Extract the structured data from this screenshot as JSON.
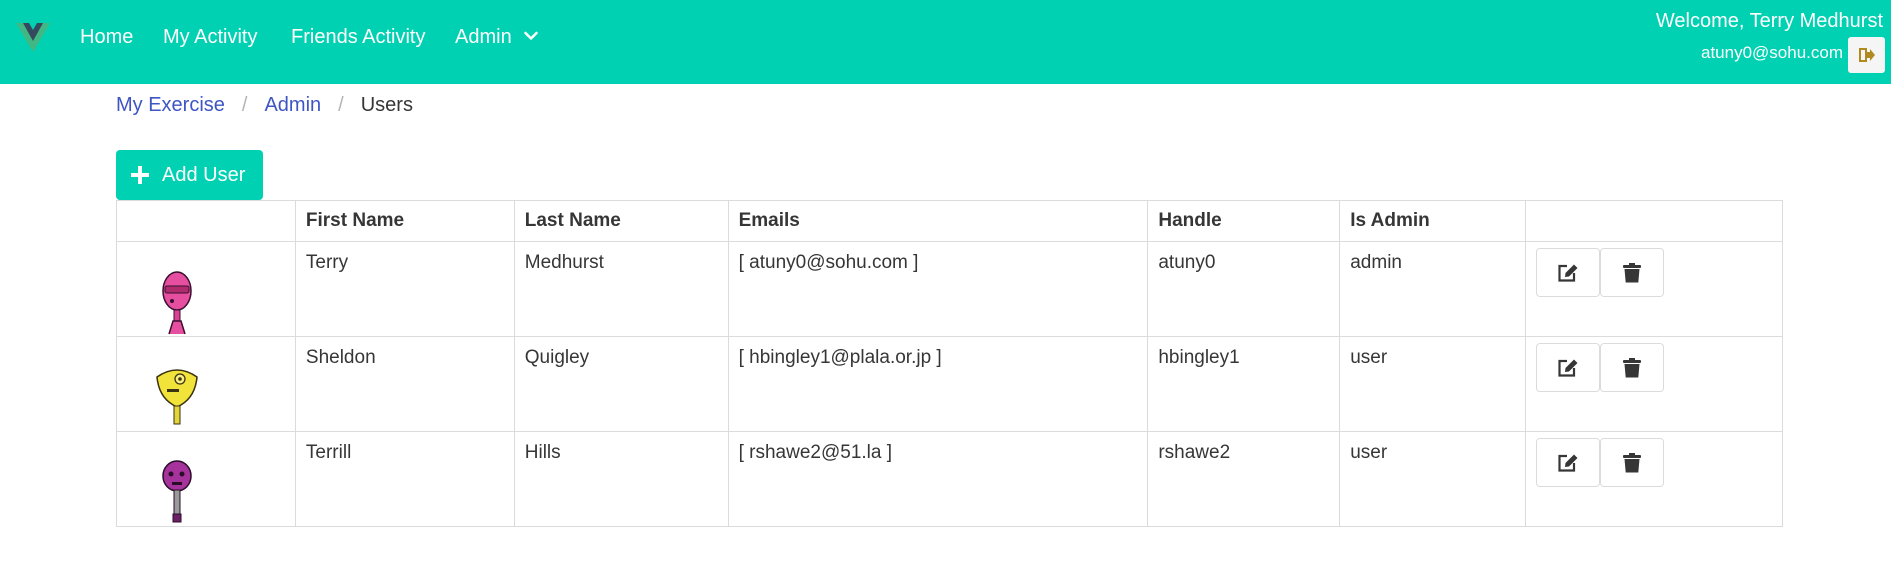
{
  "nav": {
    "items": [
      {
        "label": "Home"
      },
      {
        "label": "My Activity"
      },
      {
        "label": "Friends Activity"
      },
      {
        "label": "Admin"
      }
    ],
    "welcome": "Welcome, Terry Medhurst",
    "email": "atuny0@sohu.com"
  },
  "breadcrumb": {
    "items": [
      "My Exercise",
      "Admin",
      "Users"
    ],
    "separator": "/"
  },
  "add_button": {
    "label": "Add User"
  },
  "table": {
    "headers": [
      "",
      "First Name",
      "Last Name",
      "Emails",
      "Handle",
      "Is Admin",
      ""
    ],
    "rows": [
      {
        "first": "Terry",
        "last": "Medhurst",
        "emails": "[ atuny0@sohu.com ]",
        "handle": "atuny0",
        "role": "admin"
      },
      {
        "first": "Sheldon",
        "last": "Quigley",
        "emails": "[ hbingley1@plala.or.jp ]",
        "handle": "hbingley1",
        "role": "user"
      },
      {
        "first": "Terrill",
        "last": "Hills",
        "emails": "[ rshawe2@51.la ]",
        "handle": "rshawe2",
        "role": "user"
      }
    ]
  },
  "colors": {
    "primary": "#00d1b2",
    "link": "#3e56c4",
    "border": "#dbdbdb",
    "text": "#363636"
  },
  "icons": {
    "logo": "vue-logo-icon",
    "admin_dropdown": "chevron-down-icon",
    "logout": "sign-out-icon",
    "add": "plus-icon",
    "edit": "edit-icon",
    "delete": "trash-icon"
  }
}
